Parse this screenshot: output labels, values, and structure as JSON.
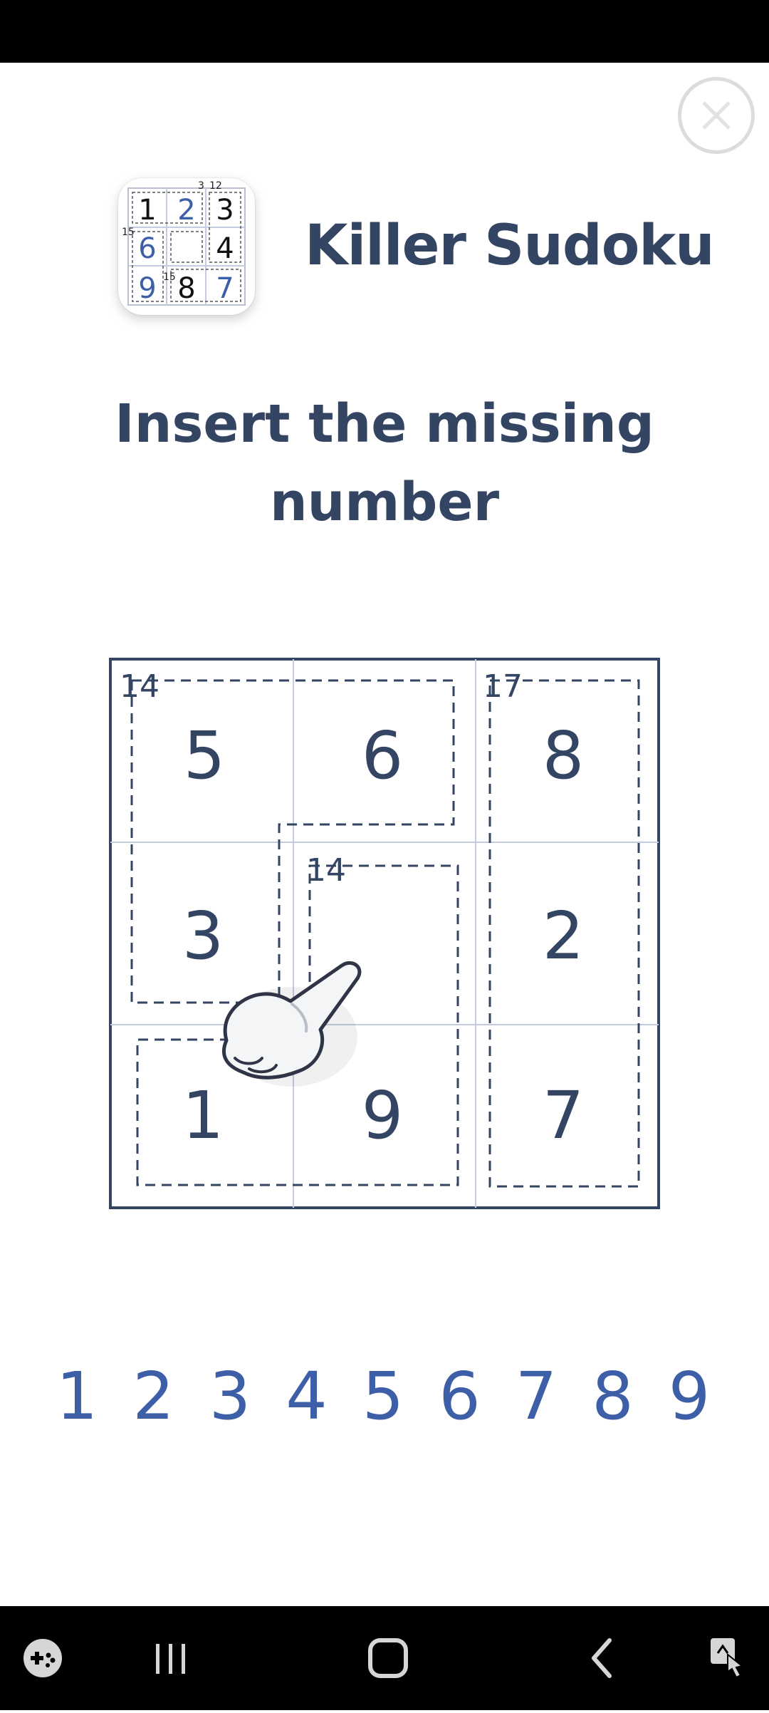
{
  "header": {
    "app_name": "Killer Sudoku",
    "app_icon": {
      "grid": [
        [
          "1",
          "2",
          "3"
        ],
        [
          "6",
          "",
          "4"
        ],
        [
          "9",
          "8",
          "7"
        ]
      ],
      "cage_sums": [
        "3",
        "12",
        "15",
        "15"
      ]
    }
  },
  "tutorial": {
    "instruction": "Insert the missing number"
  },
  "board": {
    "cells": [
      [
        "5",
        "6",
        "8"
      ],
      [
        "3",
        "",
        "2"
      ],
      [
        "1",
        "9",
        "7"
      ]
    ],
    "cage_sums": [
      "14",
      "14",
      "17"
    ],
    "selected_cell": "row 2, column 2"
  },
  "numpad": [
    "1",
    "2",
    "3",
    "4",
    "5",
    "6",
    "7",
    "8",
    "9"
  ],
  "icons": {
    "close": "close-icon",
    "hand": "hand-pointer-icon",
    "nav": [
      "game-launcher-icon",
      "recent-apps-icon",
      "home-icon",
      "back-icon",
      "accessibility-icon"
    ]
  },
  "colors": {
    "title": "#344563",
    "numpad": "#3d5fa8",
    "grid_lines": "#c5cbe0",
    "board_border": "#344563"
  }
}
